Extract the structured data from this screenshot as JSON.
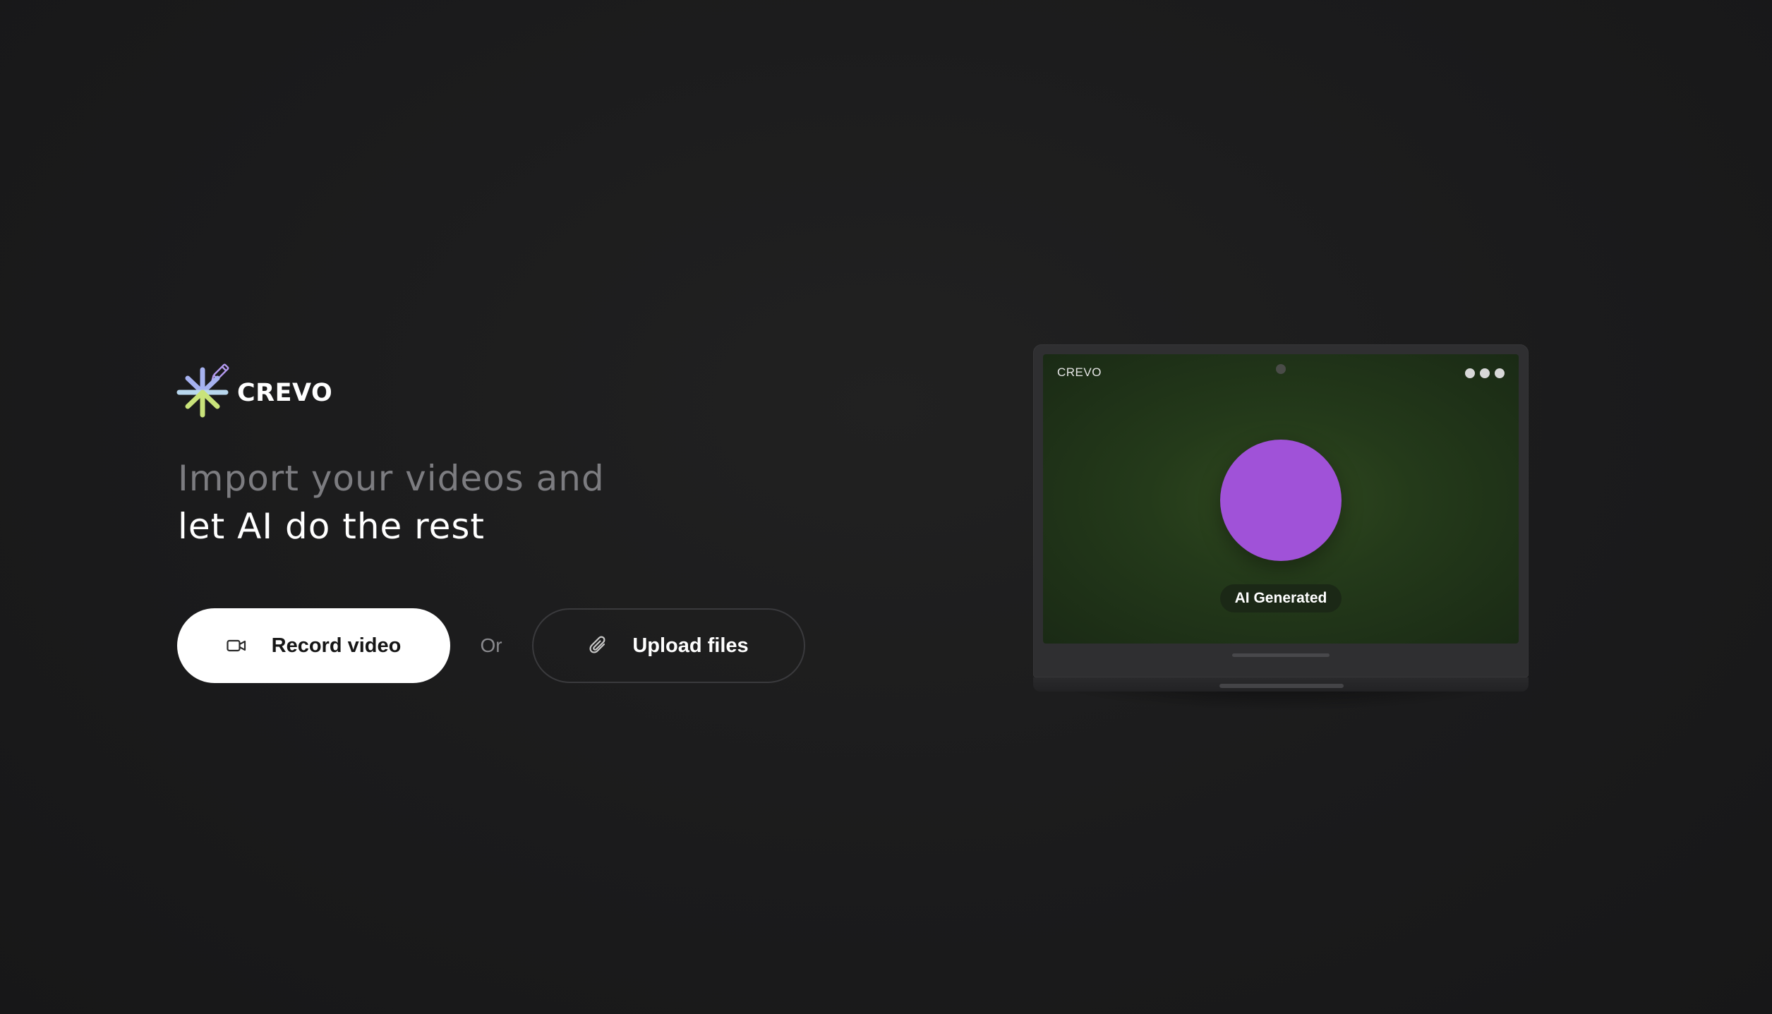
{
  "brand": {
    "name": "CREVO",
    "logo_icon": "asterisk-pencil-logo-icon",
    "colors": {
      "star_top": "#a6b2f0",
      "star_middle": "#b8d7ee",
      "star_bottom": "#c9e37a",
      "pencil": "#b49af0"
    }
  },
  "headline": {
    "line1": "Import your videos and",
    "line2": "let AI do the rest"
  },
  "actions": {
    "record": {
      "label": "Record video",
      "icon": "video-camera-icon"
    },
    "separator": "Or",
    "upload": {
      "label": "Upload files",
      "icon": "paperclip-icon"
    }
  },
  "preview": {
    "screen_brand": "CREVO",
    "menu_icon": "more-dots-icon",
    "badge": "AI Generated",
    "colors": {
      "avatar": "#a052d8",
      "screen_bg": "#243a1a"
    }
  }
}
